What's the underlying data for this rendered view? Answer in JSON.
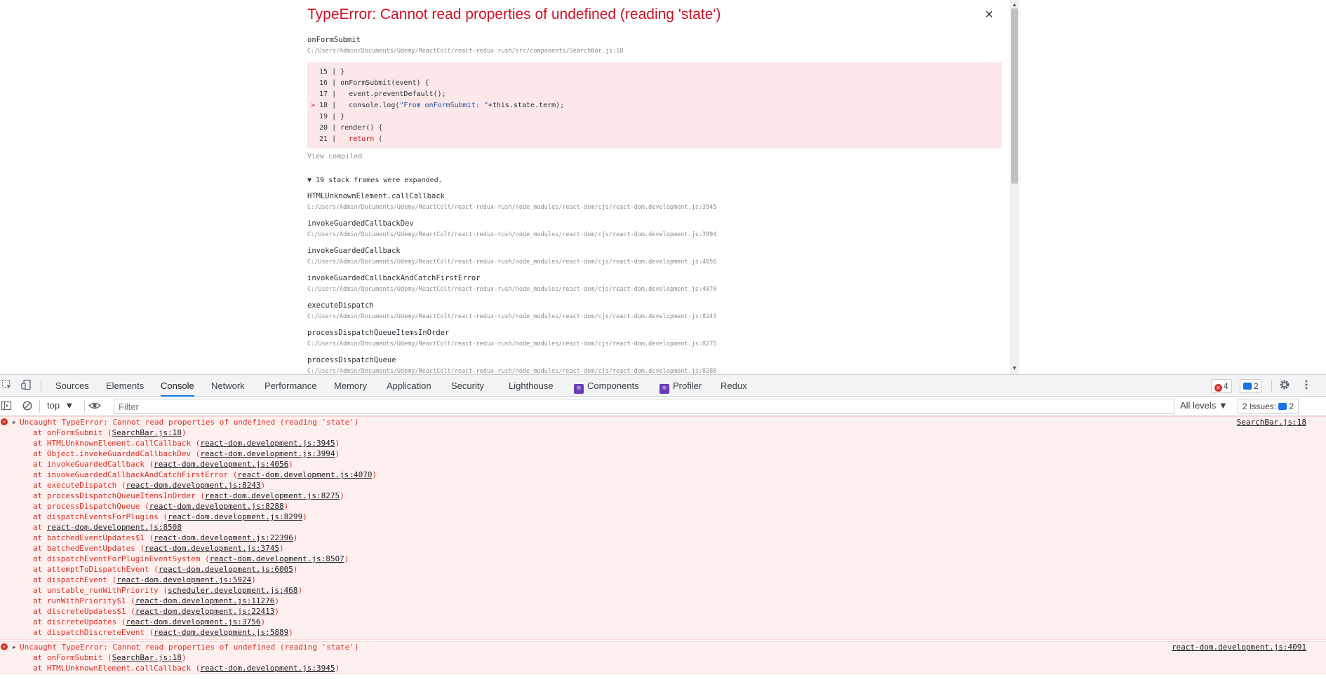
{
  "overlay": {
    "title": "TypeError: Cannot read properties of undefined (reading 'state')",
    "close_label": "×",
    "function_name": "onFormSubmit",
    "function_path": "C:/Users/Admin/Documents/Udemy/ReactColt/react-redux-rush/src/components/SearchBar.js:18",
    "code_lines": [
      {
        "gutter": "",
        "num": "15",
        "text": "}"
      },
      {
        "gutter": "",
        "num": "16",
        "text": "onFormSubmit(event) {"
      },
      {
        "gutter": "",
        "num": "17",
        "text": "  event.preventDefault();"
      },
      {
        "gutter": ">",
        "num": "18",
        "pre": "  console.log(",
        "str": "\"From onFormSubmit: \"",
        "post": "+this.state.term);"
      },
      {
        "gutter": "",
        "num": "19",
        "text": "}"
      },
      {
        "gutter": "",
        "num": "20",
        "text": "render() {"
      },
      {
        "gutter": "",
        "num": "21",
        "kw": "  return",
        "text": " ("
      }
    ],
    "view_compiled": "View compiled",
    "frames_toggle": "▼ 19 stack frames were expanded.",
    "frames": [
      {
        "name": "HTMLUnknownElement.callCallback",
        "path": "C:/Users/Admin/Documents/Udemy/ReactColt/react-redux-rush/node_modules/react-dom/cjs/react-dom.development.js:3945"
      },
      {
        "name": "invokeGuardedCallbackDev",
        "path": "C:/Users/Admin/Documents/Udemy/ReactColt/react-redux-rush/node_modules/react-dom/cjs/react-dom.development.js:3994"
      },
      {
        "name": "invokeGuardedCallback",
        "path": "C:/Users/Admin/Documents/Udemy/ReactColt/react-redux-rush/node_modules/react-dom/cjs/react-dom.development.js:4056"
      },
      {
        "name": "invokeGuardedCallbackAndCatchFirstError",
        "path": "C:/Users/Admin/Documents/Udemy/ReactColt/react-redux-rush/node_modules/react-dom/cjs/react-dom.development.js:4070"
      },
      {
        "name": "executeDispatch",
        "path": "C:/Users/Admin/Documents/Udemy/ReactColt/react-redux-rush/node_modules/react-dom/cjs/react-dom.development.js:8243"
      },
      {
        "name": "processDispatchQueueItemsInOrder",
        "path": "C:/Users/Admin/Documents/Udemy/ReactColt/react-redux-rush/node_modules/react-dom/cjs/react-dom.development.js:8275"
      },
      {
        "name": "processDispatchQueue",
        "path": "C:/Users/Admin/Documents/Udemy/ReactColt/react-redux-rush/node_modules/react-dom/cjs/react-dom.development.js:8288"
      }
    ]
  },
  "devtools": {
    "tabs": [
      "Sources",
      "Elements",
      "Console",
      "Network",
      "Performance",
      "Memory",
      "Application",
      "Security",
      "Lighthouse",
      "Components",
      "Profiler",
      "Redux"
    ],
    "active_tab": "Console",
    "error_count": "4",
    "message_count": "2",
    "context": "top",
    "filter_placeholder": "Filter",
    "levels": "All levels",
    "issues_label": "2 Issues:",
    "issues_count": "2",
    "icons": {
      "inspect": "inspect-icon",
      "device": "device-toggle-icon",
      "settings": "gear-icon",
      "more": "kebab-icon",
      "sidebar": "sidebar-icon",
      "clear": "clear-console-icon",
      "eye": "eye-icon"
    }
  },
  "console": {
    "entries": [
      {
        "message": "Uncaught TypeError: Cannot read properties of undefined (reading 'state')",
        "source": "SearchBar.js:18",
        "stack": [
          {
            "pre": "at onFormSubmit (",
            "link": "SearchBar.js:18",
            "post": ")"
          },
          {
            "pre": "at HTMLUnknownElement.callCallback (",
            "link": "react-dom.development.js:3945",
            "post": ")"
          },
          {
            "pre": "at Object.invokeGuardedCallbackDev (",
            "link": "react-dom.development.js:3994",
            "post": ")"
          },
          {
            "pre": "at invokeGuardedCallback (",
            "link": "react-dom.development.js:4056",
            "post": ")"
          },
          {
            "pre": "at invokeGuardedCallbackAndCatchFirstError (",
            "link": "react-dom.development.js:4070",
            "post": ")"
          },
          {
            "pre": "at executeDispatch (",
            "link": "react-dom.development.js:8243",
            "post": ")"
          },
          {
            "pre": "at processDispatchQueueItemsInOrder (",
            "link": "react-dom.development.js:8275",
            "post": ")"
          },
          {
            "pre": "at processDispatchQueue (",
            "link": "react-dom.development.js:8288",
            "post": ")"
          },
          {
            "pre": "at dispatchEventsForPlugins (",
            "link": "react-dom.development.js:8299",
            "post": ")"
          },
          {
            "pre": "at ",
            "link": "react-dom.development.js:8508",
            "post": ""
          },
          {
            "pre": "at batchedEventUpdates$1 (",
            "link": "react-dom.development.js:22396",
            "post": ")"
          },
          {
            "pre": "at batchedEventUpdates (",
            "link": "react-dom.development.js:3745",
            "post": ")"
          },
          {
            "pre": "at dispatchEventForPluginEventSystem (",
            "link": "react-dom.development.js:8507",
            "post": ")"
          },
          {
            "pre": "at attemptToDispatchEvent (",
            "link": "react-dom.development.js:6005",
            "post": ")"
          },
          {
            "pre": "at dispatchEvent (",
            "link": "react-dom.development.js:5924",
            "post": ")"
          },
          {
            "pre": "at unstable_runWithPriority (",
            "link": "scheduler.development.js:468",
            "post": ")"
          },
          {
            "pre": "at runWithPriority$1 (",
            "link": "react-dom.development.js:11276",
            "post": ")"
          },
          {
            "pre": "at discreteUpdates$1 (",
            "link": "react-dom.development.js:22413",
            "post": ")"
          },
          {
            "pre": "at discreteUpdates (",
            "link": "react-dom.development.js:3756",
            "post": ")"
          },
          {
            "pre": "at dispatchDiscreteEvent (",
            "link": "react-dom.development.js:5889",
            "post": ")"
          }
        ]
      },
      {
        "message": "Uncaught TypeError: Cannot read properties of undefined (reading 'state')",
        "source": "react-dom.development.js:4091",
        "stack": [
          {
            "pre": "at onFormSubmit (",
            "link": "SearchBar.js:18",
            "post": ")"
          },
          {
            "pre": "at HTMLUnknownElement.callCallback (",
            "link": "react-dom.development.js:3945",
            "post": ")"
          }
        ]
      }
    ]
  }
}
